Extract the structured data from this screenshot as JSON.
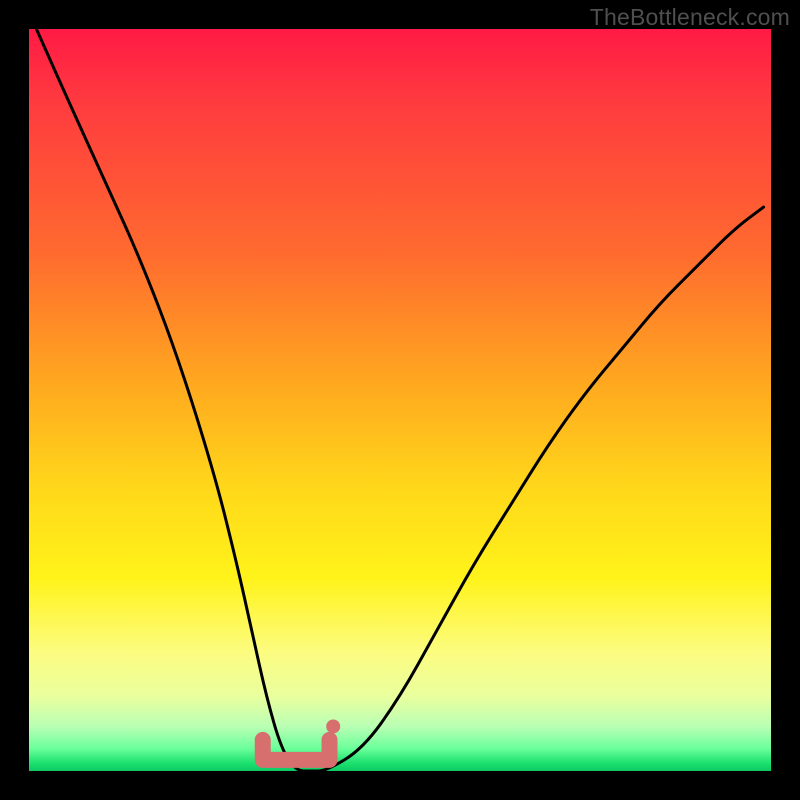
{
  "watermark": "TheBottleneck.com",
  "chart_data": {
    "type": "line",
    "title": "",
    "xlabel": "",
    "ylabel": "",
    "xlim": [
      0,
      100
    ],
    "ylim": [
      0,
      100
    ],
    "grid": false,
    "legend": false,
    "series": [
      {
        "name": "bottleneck-curve",
        "color": "#000000",
        "x": [
          1,
          5,
          10,
          15,
          20,
          25,
          28,
          30,
          32,
          34,
          36,
          38,
          40,
          45,
          50,
          55,
          60,
          65,
          70,
          75,
          80,
          85,
          90,
          95,
          99
        ],
        "values": [
          100,
          91,
          80,
          69,
          56,
          40,
          28,
          19,
          10,
          3,
          0,
          0,
          0,
          3,
          10,
          19,
          28,
          36,
          44,
          51,
          57,
          63,
          68,
          73,
          76
        ]
      }
    ],
    "minimum_marker": {
      "name": "min-band",
      "color": "#d76f6f",
      "x_range": [
        31.5,
        40.5
      ],
      "y": 1.5
    },
    "annotation_dot": {
      "name": "annotation-dot",
      "color": "#d76f6f",
      "x": 41,
      "y": 6
    },
    "background_gradient": {
      "top": "#ff1a45",
      "upper_mid": "#ffa91f",
      "mid": "#fff31a",
      "lower": "#b9ffb4",
      "bottom": "#0fc863"
    }
  }
}
